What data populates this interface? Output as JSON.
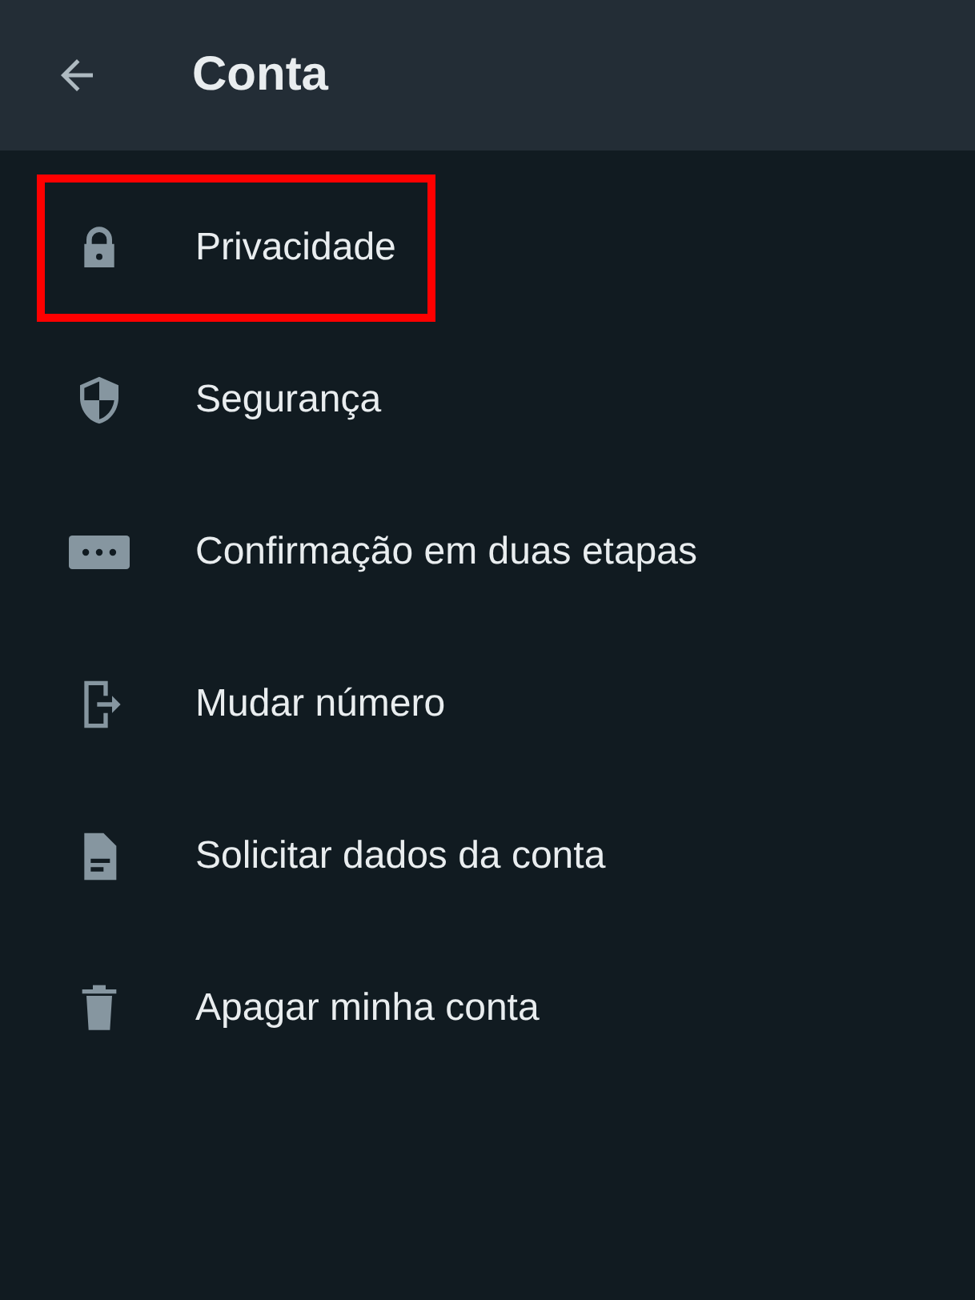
{
  "header": {
    "title": "Conta"
  },
  "items": [
    {
      "kind": "lock",
      "label": "Privacidade",
      "highlighted": true
    },
    {
      "kind": "shield",
      "label": "Segurança",
      "highlighted": false
    },
    {
      "kind": "dots",
      "label": "Confirmação em duas etapas",
      "highlighted": false
    },
    {
      "kind": "exit",
      "label": "Mudar número",
      "highlighted": false
    },
    {
      "kind": "doc",
      "label": "Solicitar dados da conta",
      "highlighted": false
    },
    {
      "kind": "trash",
      "label": "Apagar minha conta",
      "highlighted": false
    }
  ]
}
